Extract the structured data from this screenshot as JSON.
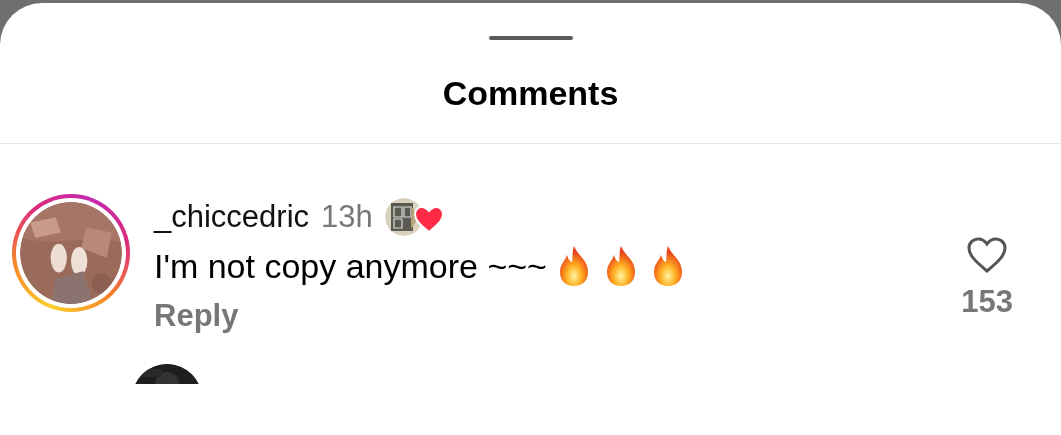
{
  "sheet": {
    "title": "Comments"
  },
  "comments": [
    {
      "kind": "full",
      "username": "_chiccedric",
      "time": "13h",
      "story_ring": true,
      "creator_liked": true,
      "text": "I'm not copy anymore ~~~",
      "emojis": [
        {
          "kind": "fire"
        },
        {
          "kind": "fire"
        },
        {
          "kind": "fire"
        }
      ],
      "reply": "Reply",
      "liked": false,
      "likes": "153"
    },
    {
      "kind": "cut"
    }
  ]
}
